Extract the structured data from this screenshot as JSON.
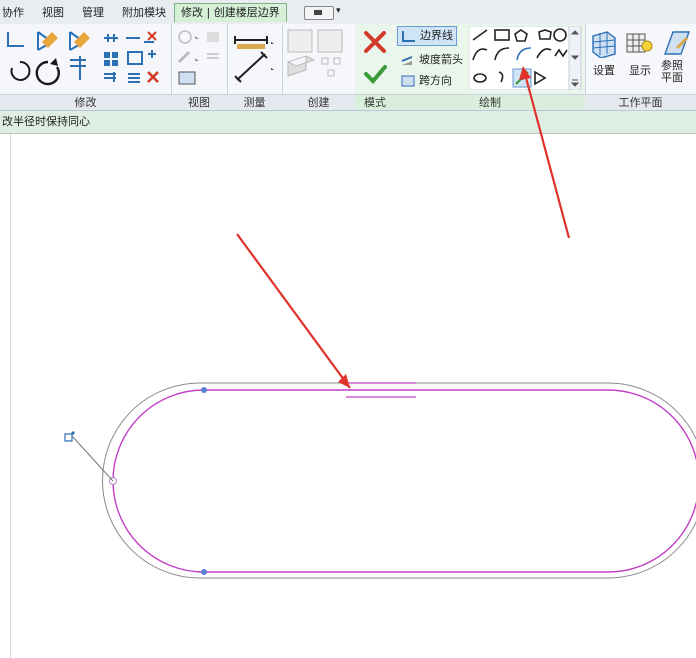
{
  "tabs": [
    {
      "label": "协作",
      "active": false
    },
    {
      "label": "视图",
      "active": false
    },
    {
      "label": "管理",
      "active": false
    },
    {
      "label": "附加模块",
      "active": false
    },
    {
      "label": "修改 | 创建楼层边界",
      "active": true
    }
  ],
  "panels": {
    "modify": "修改",
    "view": "视图",
    "measure": "测量",
    "create": "创建",
    "mode": "模式",
    "draw": "绘制",
    "workplane": "工作平面"
  },
  "draw_buttons": {
    "boundary_line": "边界线",
    "slope_arrow": "坡度箭头",
    "span_direction": "跨方向"
  },
  "workplane_buttons": {
    "set": "设置",
    "show": "显示",
    "ref_plane": "参照\n平面"
  },
  "options_bar": {
    "text": "改半径时保持同心"
  },
  "colors": {
    "accent_boundary": "#c23fc7",
    "annotation_arrow": "#e0322a",
    "cancel": "#d33a2a",
    "finish": "#3a9a3a"
  }
}
